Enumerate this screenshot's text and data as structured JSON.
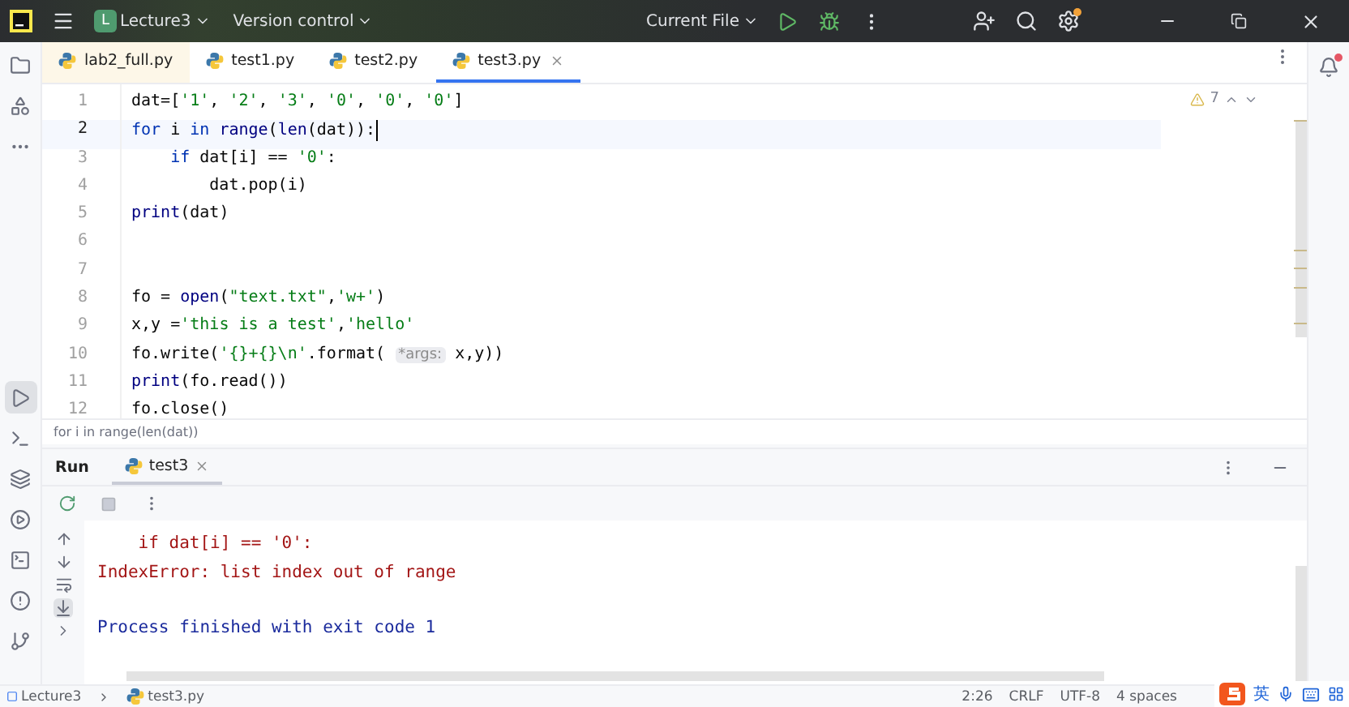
{
  "title_bar": {
    "project_badge": "L",
    "project": "Lecture3",
    "version_control": "Version control",
    "run_config": "Current File"
  },
  "left_toolbar": [
    {
      "kind": "folder",
      "selected": false
    },
    {
      "kind": "structure",
      "selected": false
    },
    {
      "kind": "more",
      "selected": false
    },
    {
      "kind": "run",
      "selected": true
    },
    {
      "kind": "console",
      "selected": false
    },
    {
      "kind": "layers",
      "selected": false
    },
    {
      "kind": "services",
      "selected": false
    },
    {
      "kind": "terminal",
      "selected": false
    },
    {
      "kind": "problems",
      "selected": false
    },
    {
      "kind": "git",
      "selected": false
    }
  ],
  "editor_tabs": [
    {
      "label": "lab2_full.py",
      "selected": false,
      "modified": true
    },
    {
      "label": "test1.py",
      "selected": false,
      "modified": false
    },
    {
      "label": "test2.py",
      "selected": false,
      "modified": false
    },
    {
      "label": "test3.py",
      "selected": true,
      "modified": false
    }
  ],
  "inspections": {
    "warnings": "7"
  },
  "code_lines": [
    {
      "number": "1",
      "selected": false,
      "tokens": [
        {
          "kind": "code",
          "text": "dat=["
        },
        {
          "kind": "string",
          "text": "'1'"
        },
        {
          "kind": "code",
          "text": ", "
        },
        {
          "kind": "string",
          "text": "'2'"
        },
        {
          "kind": "code",
          "text": ", "
        },
        {
          "kind": "string",
          "text": "'3'"
        },
        {
          "kind": "code",
          "text": ", "
        },
        {
          "kind": "string",
          "text": "'0'"
        },
        {
          "kind": "code",
          "text": ", "
        },
        {
          "kind": "string",
          "text": "'0'"
        },
        {
          "kind": "code",
          "text": ", "
        },
        {
          "kind": "string",
          "text": "'0'"
        },
        {
          "kind": "code",
          "text": "]"
        }
      ]
    },
    {
      "number": "2",
      "selected": true,
      "tokens": [
        {
          "kind": "keyword",
          "text": "for"
        },
        {
          "kind": "code",
          "text": " i "
        },
        {
          "kind": "keyword",
          "text": "in"
        },
        {
          "kind": "builtin",
          "text": " range"
        },
        {
          "kind": "code",
          "text": "("
        },
        {
          "kind": "builtin",
          "text": "len"
        },
        {
          "kind": "code",
          "text": "(dat)):"
        }
      ]
    },
    {
      "number": "3",
      "selected": false,
      "tokens": [
        {
          "kind": "keyword",
          "text": "    if"
        },
        {
          "kind": "code",
          "text": " dat[i] == "
        },
        {
          "kind": "string",
          "text": "'0'"
        },
        {
          "kind": "code",
          "text": ":"
        }
      ]
    },
    {
      "number": "4",
      "selected": false,
      "tokens": [
        {
          "kind": "code",
          "text": "        dat.pop(i)"
        }
      ]
    },
    {
      "number": "5",
      "selected": false,
      "tokens": [
        {
          "kind": "builtin",
          "text": "print"
        },
        {
          "kind": "code",
          "text": "(dat)"
        }
      ]
    },
    {
      "number": "6",
      "selected": false
    },
    {
      "number": "7",
      "selected": false
    },
    {
      "number": "8",
      "selected": false,
      "tokens": [
        {
          "kind": "code",
          "text": "fo = "
        },
        {
          "kind": "builtin",
          "text": "open"
        },
        {
          "kind": "code",
          "text": "("
        },
        {
          "kind": "string",
          "text": "\"text.txt\""
        },
        {
          "kind": "code",
          "text": ","
        },
        {
          "kind": "string",
          "text": "'w+'"
        },
        {
          "kind": "code",
          "text": ")"
        }
      ]
    },
    {
      "number": "9",
      "selected": false,
      "tokens": [
        {
          "kind": "code",
          "text": "x,y ="
        },
        {
          "kind": "string",
          "text": "'this is a test'"
        },
        {
          "kind": "code",
          "text": ","
        },
        {
          "kind": "string",
          "text": "'hello'"
        }
      ]
    },
    {
      "number": "10",
      "selected": false,
      "tokens": [
        {
          "kind": "code",
          "text": "fo.write("
        },
        {
          "kind": "string",
          "text": "'{}+{}\\n'"
        },
        {
          "kind": "code",
          "text": ".format( "
        },
        {
          "kind": "hint",
          "text": "*args:"
        },
        {
          "kind": "code",
          "text": " x,y))"
        }
      ]
    },
    {
      "number": "11",
      "selected": false,
      "tokens": [
        {
          "kind": "builtin",
          "text": "print"
        },
        {
          "kind": "code",
          "text": "(fo.read())"
        }
      ]
    },
    {
      "number": "12",
      "selected": false,
      "tokens": [
        {
          "kind": "code",
          "text": "fo.close()"
        }
      ]
    }
  ],
  "breadcrumb": "for i in range(len(dat))",
  "run_panel": {
    "title": "Run",
    "tabs": [
      {
        "label": "test3",
        "selected": true
      }
    ],
    "output": [
      {
        "kind": "error",
        "text": "    if dat[i] == '0':"
      },
      {
        "kind": "error",
        "text": "IndexError: list index out of range"
      },
      {
        "kind": "info",
        "text": "Process finished with exit code 1"
      }
    ]
  },
  "status_bar": {
    "project": "Lecture3",
    "file": "test3.py",
    "position": "2:26",
    "line_separator": "CRLF",
    "encoding": "UTF-8",
    "indent": "4 spaces"
  },
  "ime_toolbar": {
    "language": "英"
  }
}
